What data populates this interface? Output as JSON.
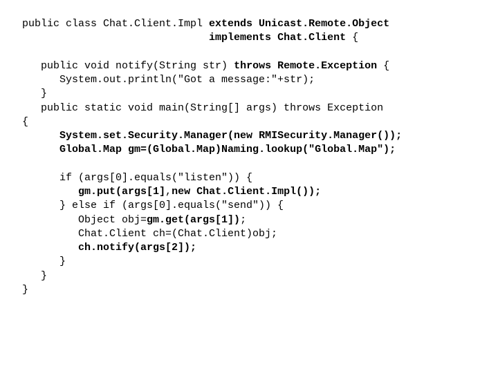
{
  "code": {
    "l01a": "public class Chat.Client.Impl ",
    "l01b": "extends Unicast.Remote.Object",
    "l02a": "                              ",
    "l02b": "implements Chat.Client",
    "l02c": " {",
    "l03": "",
    "l04a": "   public void notify(String str) ",
    "l04b": "throws Remote.Exception",
    "l04c": " {",
    "l05": "      System.out.println(\"Got a message:\"+str);",
    "l06": "   }",
    "l07": "   public static void main(String[] args) throws Exception",
    "l08": "{",
    "l09a": "      ",
    "l09b": "System.set.Security.Manager(new RMISecurity.Manager());",
    "l10a": "      ",
    "l10b": "Global.Map gm=(Global.Map)Naming.lookup(\"Global.Map\");",
    "l11": "",
    "l12": "      if (args[0].equals(\"listen\")) {",
    "l13a": "         ",
    "l13b": "gm.put(args[1]",
    "l13c": ",",
    "l13d": "new Chat.Client.Impl());",
    "l14": "      } else if (args[0].equals(\"send\")) {",
    "l15a": "         Object obj=",
    "l15b": "gm.get(args[1])",
    "l15c": ";",
    "l16": "         Chat.Client ch=(Chat.Client)obj;",
    "l17a": "         ",
    "l17b": "ch.notify(args[2]);",
    "l18": "      }",
    "l19": "   }",
    "l20": "}"
  }
}
